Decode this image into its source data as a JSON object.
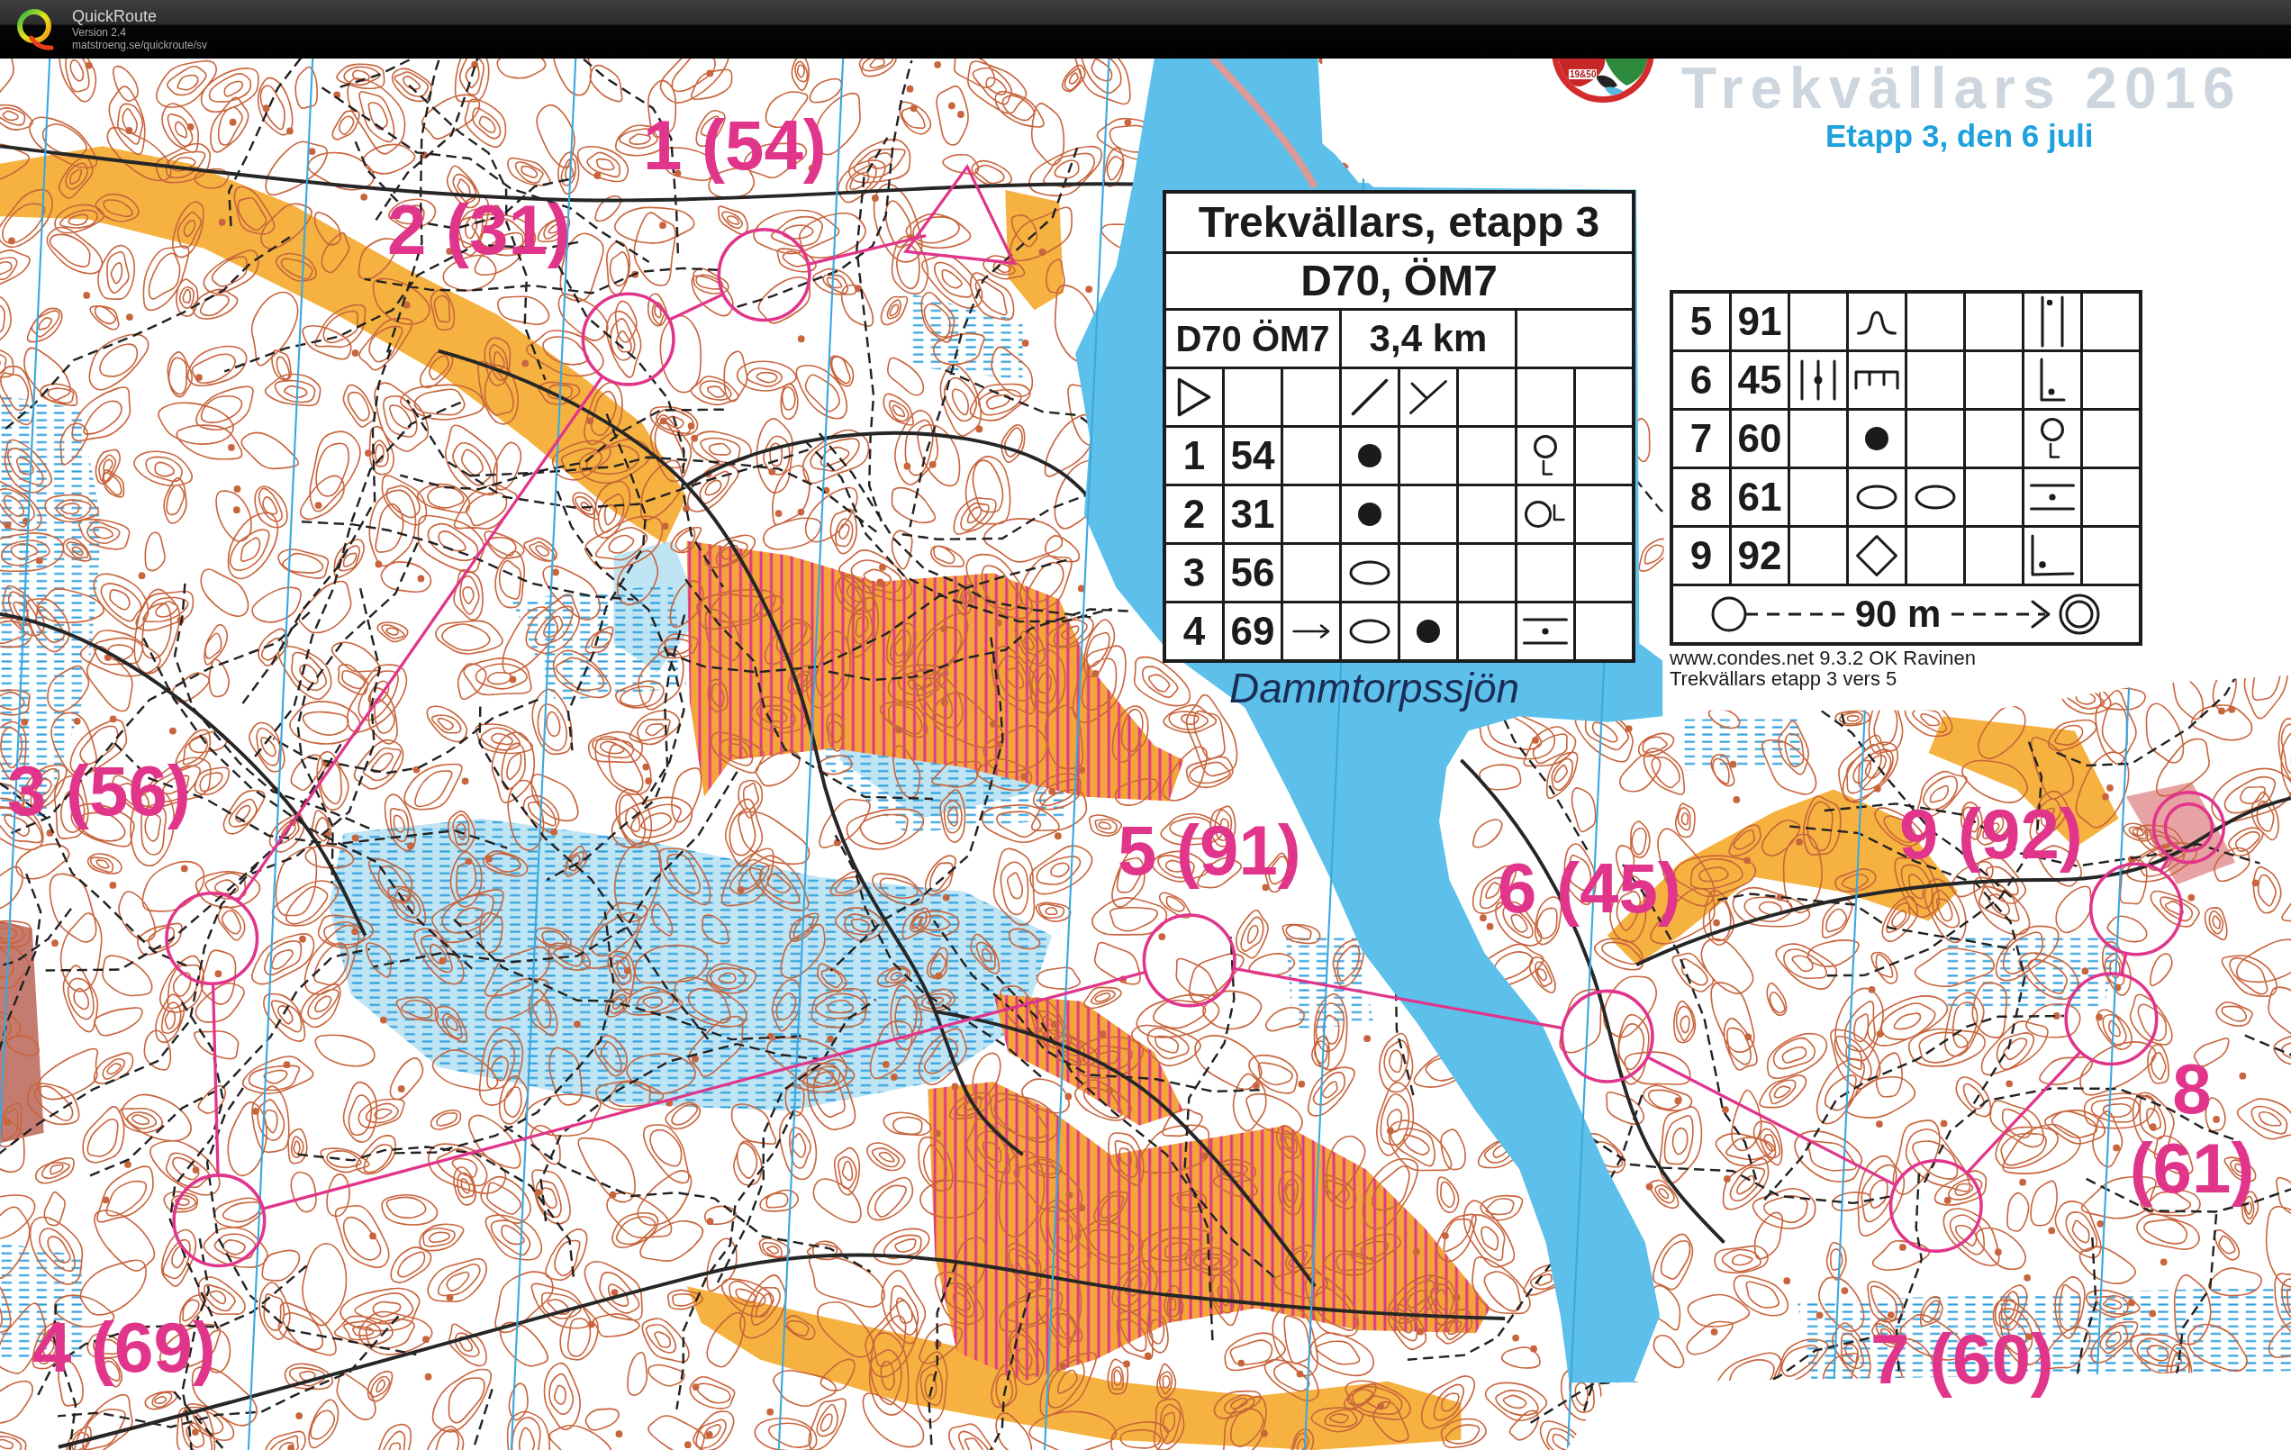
{
  "title_bar": {
    "app_name": "QuickRoute",
    "version": "Version 2.4",
    "url": "matstroeng.se/quickroute/sv"
  },
  "map_header": {
    "logo_text": "19&50",
    "event_title": "Trekvällars 2016",
    "stage_title": "Etapp 3, den 6 juli"
  },
  "controls": [
    {
      "label": "1 (54)"
    },
    {
      "label": "2 (31)"
    },
    {
      "label": "3 (56)"
    },
    {
      "label": "4 (69)"
    },
    {
      "label": "5 (91)"
    },
    {
      "label": "6 (45)"
    },
    {
      "label": "7 (60)"
    },
    {
      "label": "8 (61)"
    },
    {
      "label": "9 (92)"
    }
  ],
  "description_sheet": {
    "title": "Trekvällars, etapp 3",
    "class": "D70, ÖM7",
    "course": "D70 ÖM7",
    "length": "3,4 km",
    "rows": [
      {
        "cells": [
          {
            "kind": "triangle"
          },
          {
            "kind": "blank"
          },
          {
            "kind": "blank"
          },
          {
            "kind": "slash"
          },
          {
            "kind": "fork"
          },
          {
            "kind": "blank"
          },
          {
            "kind": "blank"
          },
          {
            "kind": "blank"
          }
        ]
      },
      {
        "cells": [
          {
            "kind": "text",
            "text": "1"
          },
          {
            "kind": "text",
            "text": "54"
          },
          {
            "kind": "blank"
          },
          {
            "kind": "dot"
          },
          {
            "kind": "blank"
          },
          {
            "kind": "blank"
          },
          {
            "kind": "circle-l-below"
          },
          {
            "kind": "blank"
          }
        ]
      },
      {
        "cells": [
          {
            "kind": "text",
            "text": "2"
          },
          {
            "kind": "text",
            "text": "31"
          },
          {
            "kind": "blank"
          },
          {
            "kind": "dot"
          },
          {
            "kind": "blank"
          },
          {
            "kind": "blank"
          },
          {
            "kind": "circle-l-right"
          },
          {
            "kind": "blank"
          }
        ]
      },
      {
        "cells": [
          {
            "kind": "text",
            "text": "3"
          },
          {
            "kind": "text",
            "text": "56"
          },
          {
            "kind": "blank"
          },
          {
            "kind": "ellipse"
          },
          {
            "kind": "blank"
          },
          {
            "kind": "blank"
          },
          {
            "kind": "blank"
          },
          {
            "kind": "blank"
          }
        ]
      },
      {
        "cells": [
          {
            "kind": "text",
            "text": "4"
          },
          {
            "kind": "text",
            "text": "69"
          },
          {
            "kind": "arrow"
          },
          {
            "kind": "ellipse"
          },
          {
            "kind": "dot"
          },
          {
            "kind": "blank"
          },
          {
            "kind": "dot-between-lines"
          },
          {
            "kind": "blank"
          }
        ]
      }
    ]
  },
  "description_sheet_continued": {
    "rows": [
      {
        "cells": [
          {
            "kind": "text",
            "text": "5"
          },
          {
            "kind": "text",
            "text": "91"
          },
          {
            "kind": "blank"
          },
          {
            "kind": "hump"
          },
          {
            "kind": "blank"
          },
          {
            "kind": "blank"
          },
          {
            "kind": "bars-dot-top"
          },
          {
            "kind": "blank"
          }
        ]
      },
      {
        "cells": [
          {
            "kind": "text",
            "text": "6"
          },
          {
            "kind": "text",
            "text": "45"
          },
          {
            "kind": "three-bars-dot"
          },
          {
            "kind": "comb"
          },
          {
            "kind": "blank"
          },
          {
            "kind": "blank"
          },
          {
            "kind": "corner-dot"
          },
          {
            "kind": "blank"
          }
        ]
      },
      {
        "cells": [
          {
            "kind": "text",
            "text": "7"
          },
          {
            "kind": "text",
            "text": "60"
          },
          {
            "kind": "blank"
          },
          {
            "kind": "dot"
          },
          {
            "kind": "blank"
          },
          {
            "kind": "blank"
          },
          {
            "kind": "circle-l-below"
          },
          {
            "kind": "blank"
          }
        ]
      },
      {
        "cells": [
          {
            "kind": "text",
            "text": "8"
          },
          {
            "kind": "text",
            "text": "61"
          },
          {
            "kind": "blank"
          },
          {
            "kind": "ellipse"
          },
          {
            "kind": "ellipse"
          },
          {
            "kind": "blank"
          },
          {
            "kind": "dot-between-lines"
          },
          {
            "kind": "blank"
          }
        ]
      },
      {
        "cells": [
          {
            "kind": "text",
            "text": "9"
          },
          {
            "kind": "text",
            "text": "92"
          },
          {
            "kind": "blank"
          },
          {
            "kind": "diamond"
          },
          {
            "kind": "blank"
          },
          {
            "kind": "blank"
          },
          {
            "kind": "wide-corner-dot"
          },
          {
            "kind": "blank"
          }
        ]
      }
    ],
    "finish": {
      "distance": "90 m"
    }
  },
  "lake_name": "Dammtorpssjön",
  "credits": [
    "www.condes.net 9.3.2 OK Ravinen",
    "Trekvällars etapp 3 vers 5"
  ]
}
